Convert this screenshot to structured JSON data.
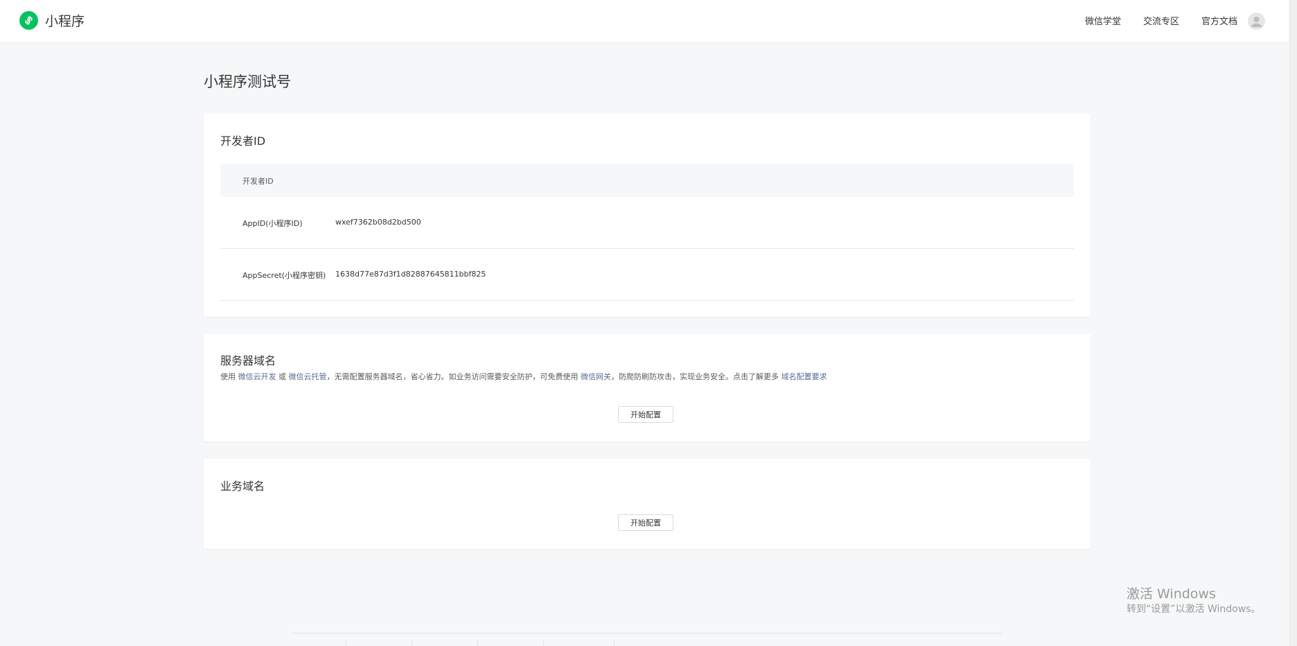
{
  "header": {
    "brand": "小程序",
    "nav": [
      "微信学堂",
      "交流专区",
      "官方文档"
    ]
  },
  "page": {
    "title": "小程序测试号"
  },
  "developer_id": {
    "title": "开发者ID",
    "table_header": "开发者ID",
    "rows": [
      {
        "label": "AppID(小程序ID)",
        "value": "wxef7362b08d2bd500"
      },
      {
        "label": "AppSecret(小程序密钥)",
        "value": "1638d77e87d3f1d82887645811bbf825"
      }
    ]
  },
  "server_domain": {
    "title": "服务器域名",
    "desc": {
      "t1": "使用 ",
      "link1": "微信云开发",
      "t2": " 或 ",
      "link2": "微信云托管",
      "t3": "，无需配置服务器域名，省心省力。如业务访问需要安全防护，可免费使用 ",
      "link3": "微信网关",
      "t4": "，防爬防刷防攻击，实现业务安全。点击了解更多 ",
      "link4": "域名配置要求"
    },
    "button": "开始配置"
  },
  "business_domain": {
    "title": "业务域名",
    "button": "开始配置"
  },
  "watermark": {
    "title": "激活 Windows",
    "subtitle": "转到“设置”以激活 Windows。"
  },
  "colors": {
    "brand_green": "#07c160",
    "link_blue": "#576b95",
    "background": "#f6f7f8"
  }
}
